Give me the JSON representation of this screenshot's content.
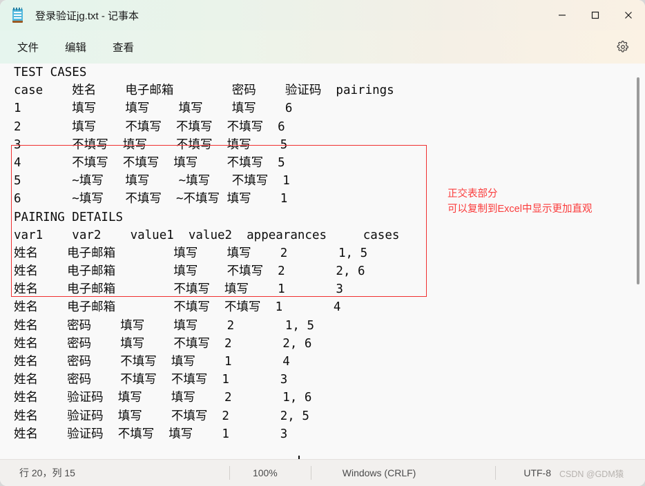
{
  "window": {
    "title": "登录验证jg.txt - 记事本",
    "app_icon": "notepad-icon",
    "controls": {
      "minimize": "minimize-icon",
      "maximize": "maximize-icon",
      "close": "close-icon"
    }
  },
  "menubar": {
    "items": [
      {
        "label": "文件"
      },
      {
        "label": "编辑"
      },
      {
        "label": "查看"
      }
    ],
    "settings_icon": "gear-icon"
  },
  "document": {
    "lines": [
      "TEST CASES",
      "case\t姓名\t电子邮箱\t密码\t验证码\tpairings",
      "1\t填写\t填写\t填写\t填写\t6",
      "2\t填写\t不填写\t不填写\t不填写\t6",
      "3\t不填写\t填写\t不填写\t填写\t5",
      "4\t不填写\t不填写\t填写\t不填写\t5",
      "5\t~填写\t填写\t~填写\t不填写\t1",
      "6\t~填写\t不填写\t~不填写\t填写\t1",
      "PAIRING DETAILS",
      "var1\tvar2\tvalue1\tvalue2\tappearances\tcases",
      "姓名\t电子邮箱\t填写\t填写\t2\t1, 5",
      "姓名\t电子邮箱\t填写\t不填写\t2\t2, 6",
      "姓名\t电子邮箱\t不填写\t填写\t1\t3",
      "姓名\t电子邮箱\t不填写\t不填写\t1\t4",
      "姓名\t密码\t填写\t填写\t2\t1, 5",
      "姓名\t密码\t填写\t不填写\t2\t2, 6",
      "姓名\t密码\t不填写\t填写\t1\t4",
      "姓名\t密码\t不填写\t不填写\t1\t3",
      "姓名\t验证码\t填写\t填写\t2\t1, 6",
      "姓名\t验证码\t填写\t不填写\t2\t2, 5",
      "姓名\t验证码\t不填写\t填写\t1\t3"
    ],
    "test_cases": {
      "section_title": "TEST CASES",
      "headers": [
        "case",
        "姓名",
        "电子邮箱",
        "密码",
        "验证码",
        "pairings"
      ],
      "rows": [
        [
          "1",
          "填写",
          "填写",
          "填写",
          "填写",
          "6"
        ],
        [
          "2",
          "填写",
          "不填写",
          "不填写",
          "不填写",
          "6"
        ],
        [
          "3",
          "不填写",
          "填写",
          "不填写",
          "填写",
          "5"
        ],
        [
          "4",
          "不填写",
          "不填写",
          "填写",
          "不填写",
          "5"
        ],
        [
          "5",
          "~填写",
          "填写",
          "~填写",
          "不填写",
          "1"
        ],
        [
          "6",
          "~填写",
          "不填写",
          "~不填写",
          "填写",
          "1"
        ]
      ]
    },
    "pairing_details": {
      "section_title": "PAIRING DETAILS",
      "headers": [
        "var1",
        "var2",
        "value1",
        "value2",
        "appearances",
        "cases"
      ],
      "rows": [
        [
          "姓名",
          "电子邮箱",
          "填写",
          "填写",
          "2",
          "1, 5"
        ],
        [
          "姓名",
          "电子邮箱",
          "填写",
          "不填写",
          "2",
          "2, 6"
        ],
        [
          "姓名",
          "电子邮箱",
          "不填写",
          "填写",
          "1",
          "3"
        ],
        [
          "姓名",
          "电子邮箱",
          "不填写",
          "不填写",
          "1",
          "4"
        ],
        [
          "姓名",
          "密码",
          "填写",
          "填写",
          "2",
          "1, 5"
        ],
        [
          "姓名",
          "密码",
          "填写",
          "不填写",
          "2",
          "2, 6"
        ],
        [
          "姓名",
          "密码",
          "不填写",
          "填写",
          "1",
          "4"
        ],
        [
          "姓名",
          "密码",
          "不填写",
          "不填写",
          "1",
          "3"
        ],
        [
          "姓名",
          "验证码",
          "填写",
          "填写",
          "2",
          "1, 6"
        ],
        [
          "姓名",
          "验证码",
          "填写",
          "不填写",
          "2",
          "2, 5"
        ],
        [
          "姓名",
          "验证码",
          "不填写",
          "填写",
          "1",
          "3"
        ]
      ]
    }
  },
  "annotation": {
    "line1": "正交表部分",
    "line2": "可以复制到Excel中显示更加直观",
    "color": "#fa3c3c"
  },
  "highlight_box": {
    "color": "#f03030"
  },
  "statusbar": {
    "cursor": "行 20，列 15",
    "zoom": "100%",
    "line_ending": "Windows (CRLF)",
    "encoding": "UTF-8",
    "watermark": "CSDN @GDM猿"
  }
}
